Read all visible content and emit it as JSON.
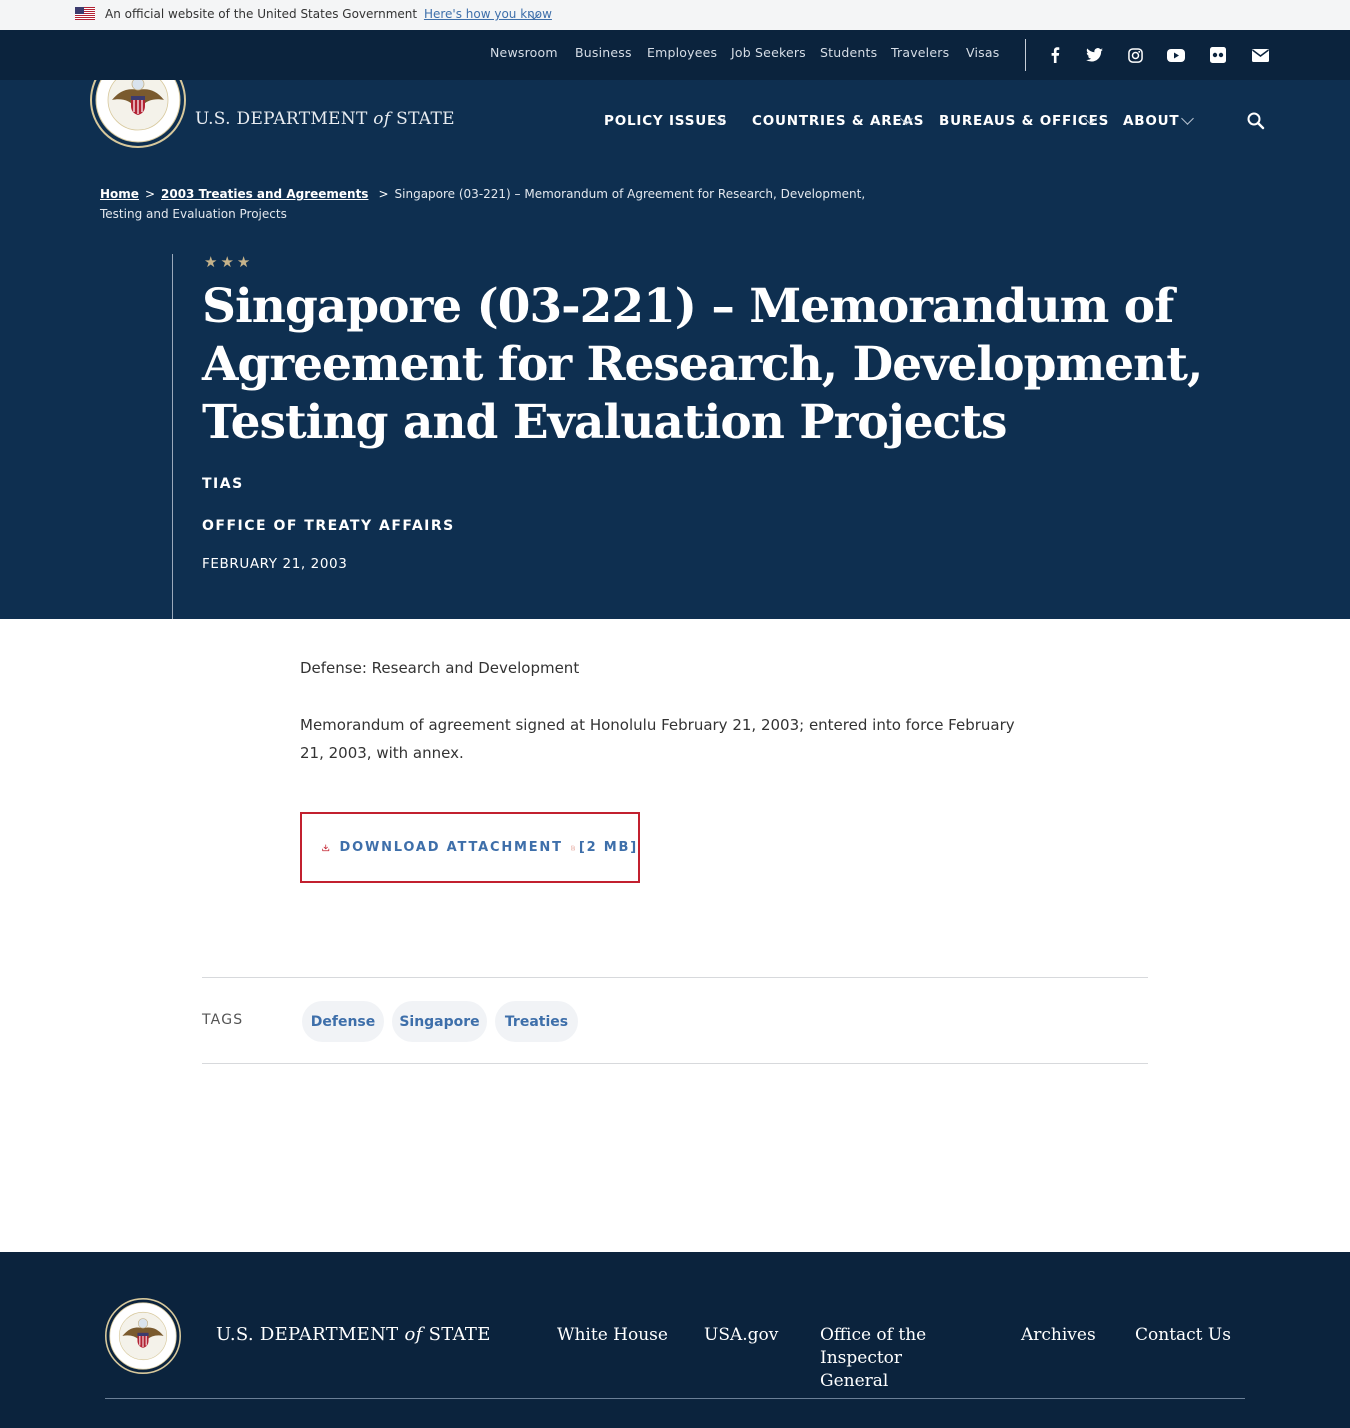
{
  "gov_banner": {
    "text": "An official website of the United States Government",
    "link": "Here's how you know"
  },
  "utility_nav": {
    "links": [
      "Newsroom",
      "Business",
      "Employees",
      "Job Seekers",
      "Students",
      "Travelers",
      "Visas"
    ],
    "social_icons": [
      "facebook-icon",
      "twitter-icon",
      "instagram-icon",
      "youtube-icon",
      "flickr-icon",
      "email-icon"
    ]
  },
  "header": {
    "logo": {
      "prefix": "U.S. DEPARTMENT ",
      "of": "of",
      "suffix": " STATE"
    },
    "nav": [
      "POLICY ISSUES",
      "COUNTRIES & AREAS",
      "BUREAUS & OFFICES",
      "ABOUT"
    ]
  },
  "breadcrumb": {
    "home": "Home",
    "parent": "2003 Treaties and Agreements",
    "separator": ">",
    "current": "Singapore (03-221) – Memorandum of Agreement for Research, Development, Testing and Evaluation Projects"
  },
  "page": {
    "stars": "★★★",
    "title": "Singapore (03-221) – Memorandum of Agreement for Research, Development, Testing and Evaluation Projects",
    "tag_line": "TIAS",
    "office": "OFFICE OF TREATY AFFAIRS",
    "date": "FEBRUARY 21, 2003"
  },
  "content": {
    "category": "Defense: Research and Development",
    "description": "Memorandum of agreement signed at Honolulu February 21, 2003; entered into force February 21, 2003, with annex.",
    "download_label": "DOWNLOAD ATTACHMENT",
    "download_size": "[2 MB]"
  },
  "tags": {
    "label": "TAGS",
    "items": [
      "Defense",
      "Singapore",
      "Treaties"
    ]
  },
  "footer": {
    "logo": {
      "prefix": "U.S. DEPARTMENT ",
      "of": "of",
      "suffix": " STATE"
    },
    "links": [
      "White House",
      "USA.gov",
      "Office of the Inspector General",
      "Archives",
      "Contact Us"
    ]
  },
  "colors": {
    "masthead": "#0e2f50",
    "utility_bar": "#0b233d",
    "link_blue": "#3e6faa",
    "download_border": "#c2202f",
    "star_gold": "#c6b38a"
  }
}
